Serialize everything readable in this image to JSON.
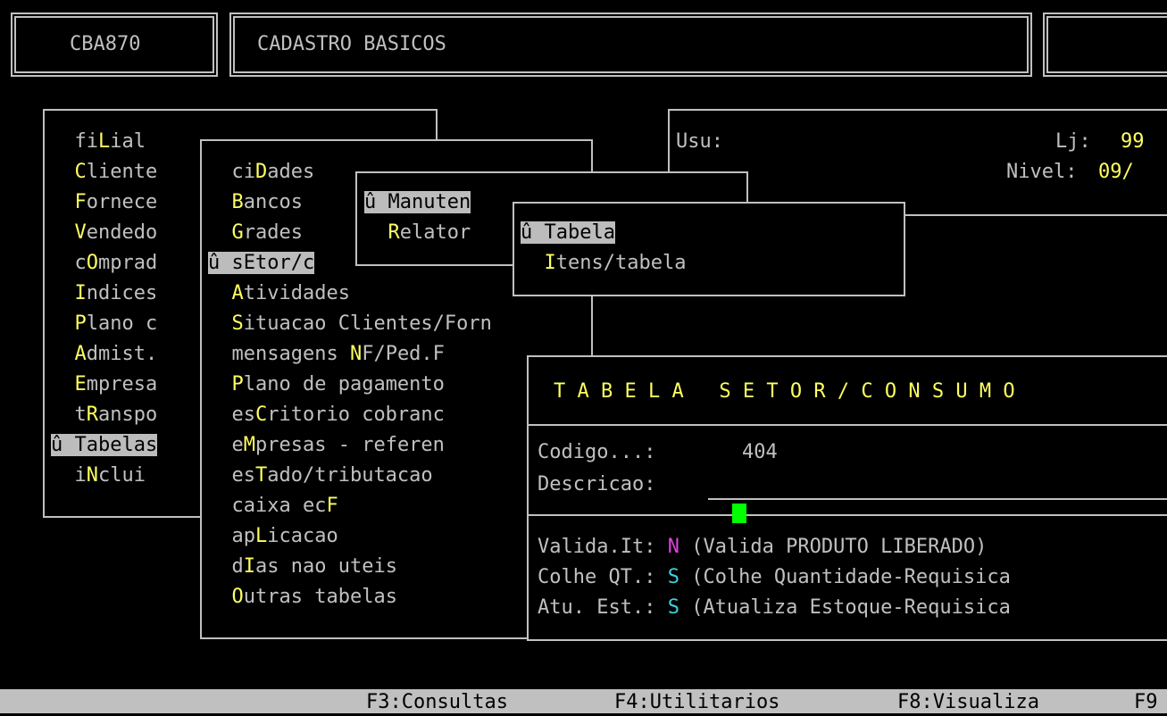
{
  "header": {
    "program_code": "CBA870",
    "title": "CADASTRO BASICOS"
  },
  "info": {
    "user_label": "Usu:",
    "store_label": "Lj:",
    "store_value": "99",
    "level_label": "Nivel:",
    "level_value": "09/"
  },
  "main_menu": {
    "items": [
      {
        "pre": "  fi",
        "key": "L",
        "post": "ial"
      },
      {
        "pre": "  ",
        "key": "C",
        "post": "liente"
      },
      {
        "pre": "  ",
        "key": "F",
        "post": "ornece"
      },
      {
        "pre": "  ",
        "key": "V",
        "post": "endedo"
      },
      {
        "pre": "  c",
        "key": "O",
        "post": "mprad"
      },
      {
        "pre": "  ",
        "key": "I",
        "post": "ndices"
      },
      {
        "pre": "  ",
        "key": "P",
        "post": "lano c"
      },
      {
        "pre": "  ",
        "key": "A",
        "post": "dmist."
      },
      {
        "pre": "  ",
        "key": "E",
        "post": "mpresa"
      },
      {
        "pre": "  t",
        "key": "R",
        "post": "anspo"
      },
      {
        "selected": "û Tabelas"
      },
      {
        "pre": "  i",
        "key": "N",
        "post": "clui"
      }
    ]
  },
  "tabelas_menu": {
    "items": [
      {
        "pre": "  ci",
        "key": "D",
        "post": "ades"
      },
      {
        "pre": "  ",
        "key": "B",
        "post": "ancos"
      },
      {
        "pre": "  ",
        "key": "G",
        "post": "rades"
      },
      {
        "selected": "û sEtor/c"
      },
      {
        "pre": "  ",
        "key": "A",
        "post": "tividades"
      },
      {
        "pre": "  ",
        "key": "S",
        "post": "ituacao Clientes/Forn"
      },
      {
        "pre": "  mensagens ",
        "key": "N",
        "post": "F/Ped.F"
      },
      {
        "pre": "  ",
        "key": "P",
        "post": "lano de pagamento"
      },
      {
        "pre": "  es",
        "key": "C",
        "post": "ritorio cobranc"
      },
      {
        "pre": "  e",
        "key": "M",
        "post": "presas - referen"
      },
      {
        "pre": "  es",
        "key": "T",
        "post": "ado/tributacao"
      },
      {
        "pre": "  caixa ec",
        "key": "F",
        "post": ""
      },
      {
        "pre": "  ap",
        "key": "L",
        "post": "icacao"
      },
      {
        "pre": "  d",
        "key": "I",
        "post": "as nao uteis"
      },
      {
        "pre": "  ",
        "key": "O",
        "post": "utras tabelas"
      }
    ]
  },
  "setor_menu": {
    "items": [
      {
        "selected": "û Manuten"
      },
      {
        "pre": "  ",
        "key": "R",
        "post": "elator"
      }
    ]
  },
  "manut_menu": {
    "items": [
      {
        "selected": "û Tabela"
      },
      {
        "pre": "  ",
        "key": "I",
        "post": "tens/tabela"
      }
    ]
  },
  "form": {
    "title": "T A B E L A   S E T O R / C O N S U M O",
    "codigo_label": "Codigo...:",
    "codigo_value": "404",
    "descricao_label": "Descricao:",
    "descricao_value": "",
    "fields": [
      {
        "label": "Valida.It:",
        "value": "N",
        "color": "magenta",
        "desc": "(Valida PRODUTO LIBERADO)"
      },
      {
        "label": "Colhe QT.:",
        "value": "S",
        "color": "cyan",
        "desc": "(Colhe Quantidade-Requisica"
      },
      {
        "label": "Atu. Est.:",
        "value": "S",
        "color": "cyan",
        "desc": "(Atualiza Estoque-Requisica"
      }
    ]
  },
  "status_bar": {
    "f3": "F3:Consultas",
    "f4": "F4:Utilitarios",
    "f8": "F8:Visualiza",
    "f9": "F9"
  }
}
